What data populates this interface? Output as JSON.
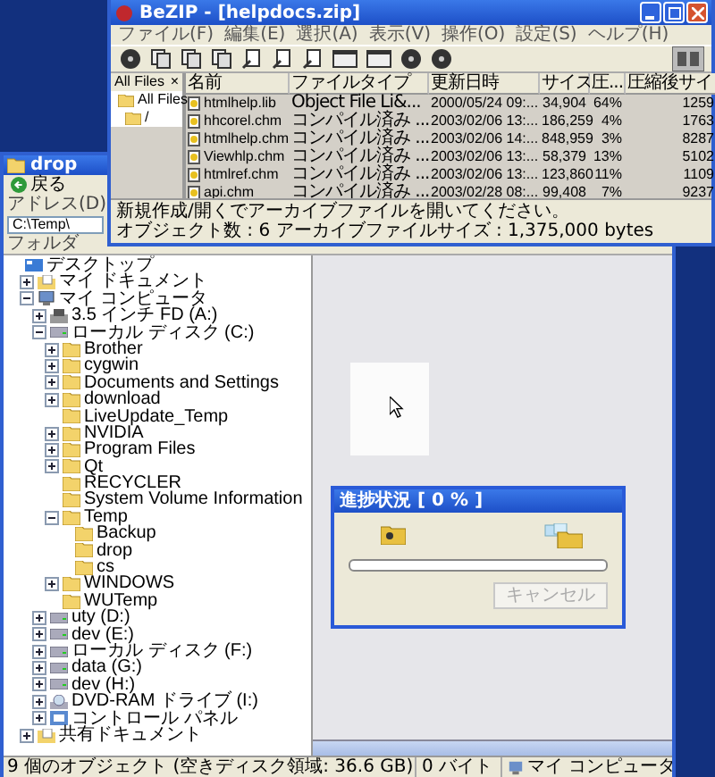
{
  "bezip_window": {
    "title": "BeZIP - [helpdocs.zip]",
    "menu": [
      "ファイル(F)",
      "編集(E)",
      "選択(A)",
      "表示(V)",
      "操作(O)",
      "設定(S)",
      "ヘルプ(H)"
    ],
    "side_pane": {
      "title": "All Files",
      "close": "×",
      "tree": [
        {
          "label": "All Files",
          "children": [
            {
              "label": "/"
            }
          ]
        }
      ]
    },
    "columns": [
      "名前",
      "ファイルタイプ",
      "更新日時",
      "サイズ",
      "圧...",
      "圧縮後サイ"
    ],
    "rows": [
      [
        "htmlhelp.lib",
        "Object File Li&...",
        "2000/05/24 09:...",
        "34,904",
        "64%",
        "1259"
      ],
      [
        "hhcorel.chm",
        "コンパイル済み ...",
        "2003/02/06 13:...",
        "186,259",
        "4%",
        "1763"
      ],
      [
        "htmlhelp.chm",
        "コンパイル済み ...",
        "2003/02/06 14:...",
        "848,959",
        "3%",
        "8287"
      ],
      [
        "Viewhlp.chm",
        "コンパイル済み ...",
        "2003/02/06 13:...",
        "58,379",
        "13%",
        "5102"
      ],
      [
        "htmlref.chm",
        "コンパイル済み ...",
        "2003/02/06 13:...",
        "123,860",
        "11%",
        "1109"
      ],
      [
        "api.chm",
        "コンパイル済み ...",
        "2003/02/28 08:...",
        "99,408",
        "7%",
        "9237"
      ]
    ],
    "status": [
      "新規作成/開くでアーカイブファイルを開いてください。",
      "オブジェクト数 : 6 アーカイブファイルサイズ : 1,375,000 bytes"
    ]
  },
  "explorer_window": {
    "title": "drop",
    "back": "戻る",
    "address_label": "アドレス(D)",
    "address": "C:\\Temp\\",
    "folders_title": "フォルダ",
    "tree": [
      {
        "label": "デスクトップ",
        "kind": "desktop",
        "children": [
          {
            "label": "マイ ドキュメント",
            "kind": "documents",
            "expanded": false
          },
          {
            "label": "マイ コンピュータ",
            "kind": "computer",
            "expanded": true,
            "children": [
              {
                "label": "3.5 インチ FD (A:)",
                "kind": "floppy",
                "expanded": false
              },
              {
                "label": "ローカル ディスク (C:)",
                "kind": "drive",
                "expanded": true,
                "children": [
                  {
                    "label": "Brother",
                    "kind": "folder",
                    "expanded": false
                  },
                  {
                    "label": "cygwin",
                    "kind": "folder",
                    "expanded": false
                  },
                  {
                    "label": "Documents and Settings",
                    "kind": "folder",
                    "expanded": false
                  },
                  {
                    "label": "download",
                    "kind": "folder",
                    "expanded": false
                  },
                  {
                    "label": "LiveUpdate_Temp",
                    "kind": "folder"
                  },
                  {
                    "label": "NVIDIA",
                    "kind": "folder",
                    "expanded": false
                  },
                  {
                    "label": "Program Files",
                    "kind": "folder",
                    "expanded": false
                  },
                  {
                    "label": "Qt",
                    "kind": "folder",
                    "expanded": false
                  },
                  {
                    "label": "RECYCLER",
                    "kind": "folder"
                  },
                  {
                    "label": "System Volume Information",
                    "kind": "folder"
                  },
                  {
                    "label": "Temp",
                    "kind": "folder",
                    "expanded": true,
                    "children": [
                      {
                        "label": "Backup",
                        "kind": "folder"
                      },
                      {
                        "label": "drop",
                        "kind": "folder"
                      },
                      {
                        "label": "cs",
                        "kind": "folder"
                      }
                    ]
                  },
                  {
                    "label": "WINDOWS",
                    "kind": "folder",
                    "expanded": false
                  },
                  {
                    "label": "WUTemp",
                    "kind": "folder"
                  }
                ]
              },
              {
                "label": "uty (D:)",
                "kind": "drive",
                "expanded": false
              },
              {
                "label": "dev (E:)",
                "kind": "drive",
                "expanded": false
              },
              {
                "label": "ローカル ディスク (F:)",
                "kind": "drive",
                "expanded": false
              },
              {
                "label": "data (G:)",
                "kind": "drive",
                "expanded": false
              },
              {
                "label": "dev (H:)",
                "kind": "drive",
                "expanded": false
              },
              {
                "label": "DVD-RAM ドライブ (I:)",
                "kind": "dvd",
                "expanded": false
              },
              {
                "label": "コントロール パネル",
                "kind": "panel",
                "expanded": false
              }
            ]
          },
          {
            "label": "共有ドキュメント",
            "kind": "documents",
            "expanded": false
          }
        ]
      }
    ],
    "status": [
      "9 個のオブジェクト (空きディスク領域: 36.6 GB)",
      "0 バイト",
      "マイ コンピュータ"
    ]
  },
  "progress_dialog": {
    "title": "進捗状況 [ 0 % ]",
    "level": 0,
    "cancel": {
      "label": "キャンセル",
      "disabled": true
    }
  }
}
